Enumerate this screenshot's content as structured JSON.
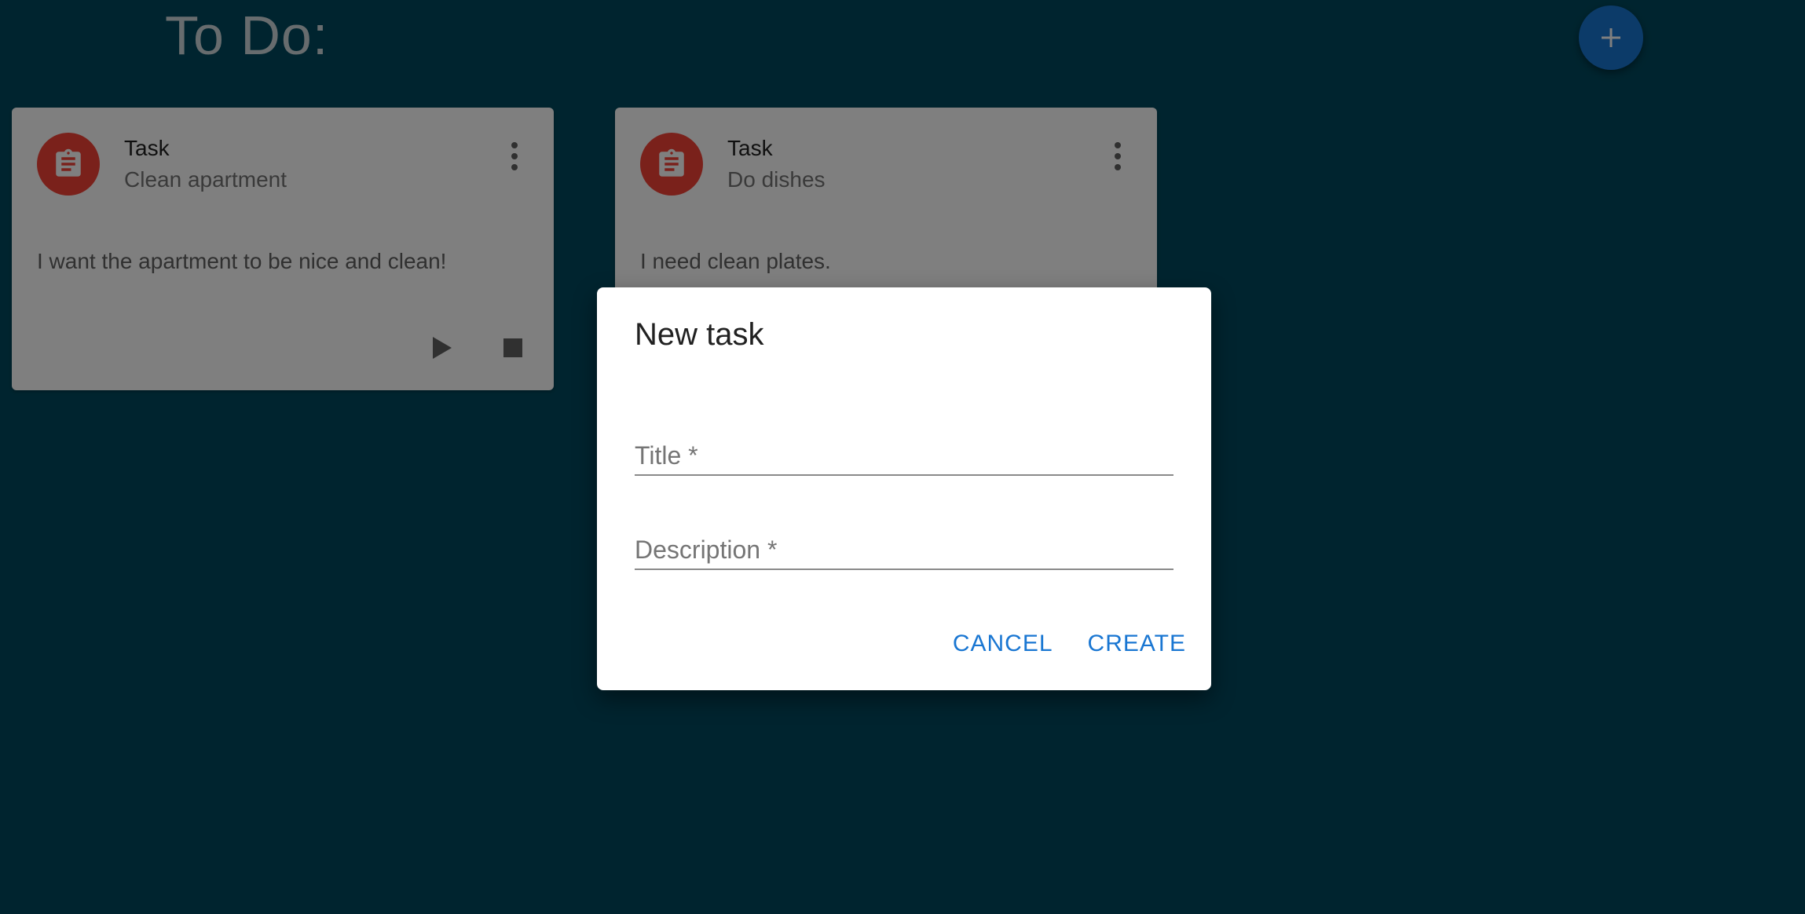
{
  "page": {
    "title": "To Do:"
  },
  "fab": {
    "icon": "plus-icon",
    "color": "#1976d2"
  },
  "cards": [
    {
      "title": "Task",
      "subtitle": "Clean apartment",
      "body": "I want the apartment to be nice and clean!",
      "avatar_icon": "clipboard-icon",
      "avatar_color": "#f44336"
    },
    {
      "title": "Task",
      "subtitle": "Do dishes",
      "body": "I need clean plates.",
      "avatar_icon": "clipboard-icon",
      "avatar_color": "#f44336"
    }
  ],
  "dialog": {
    "title": "New task",
    "fields": {
      "title_label": "Title *",
      "description_label": "Description *"
    },
    "buttons": {
      "cancel": "CANCEL",
      "create": "CREATE"
    }
  },
  "colors": {
    "background": "#00495e",
    "accent": "#1976d2",
    "avatar": "#f44336"
  }
}
